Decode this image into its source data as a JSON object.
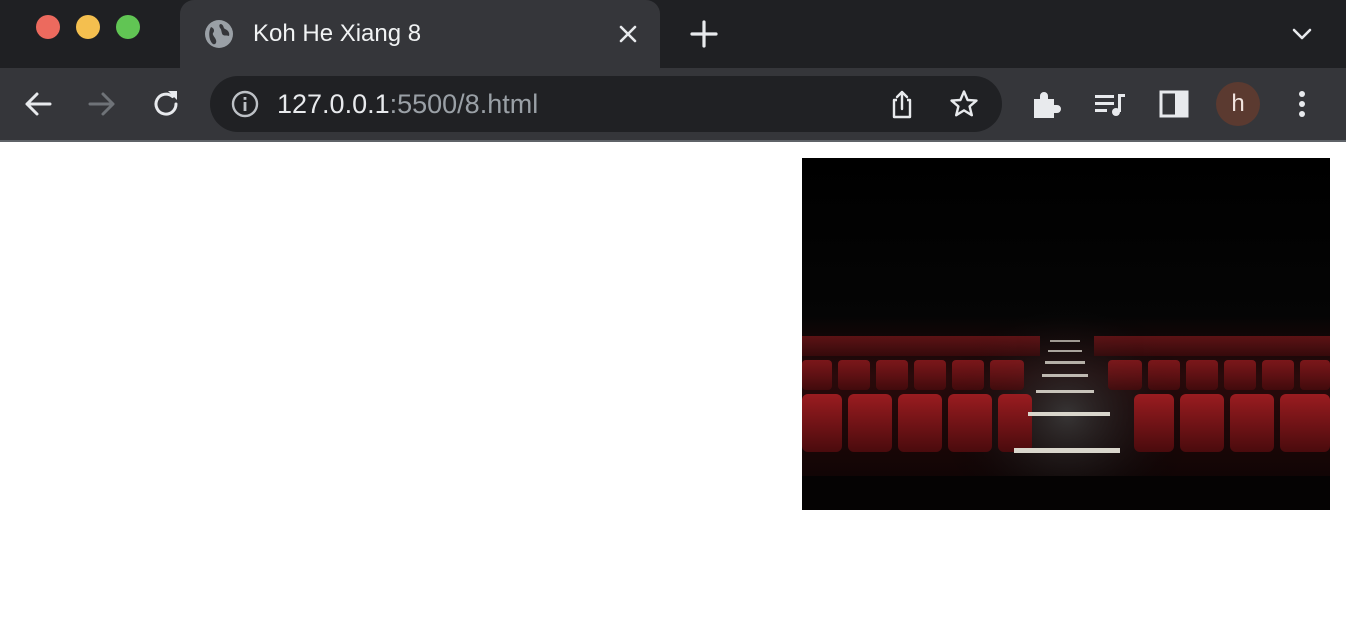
{
  "window": {
    "controls": [
      "close",
      "minimize",
      "maximize"
    ]
  },
  "tab": {
    "title": "Koh He Xiang 8",
    "icon": "globe-icon"
  },
  "toolbar": {
    "url_host": "127.0.0.1",
    "url_path": ":5500/8.html",
    "profile_initial": "h",
    "icons": [
      "back-icon",
      "forward-icon",
      "reload-icon",
      "info-icon",
      "share-icon",
      "star-icon",
      "extensions-icon",
      "media-icon",
      "side-panel-icon",
      "menu-icon"
    ]
  },
  "page": {
    "image": {
      "subject": "theater-seats",
      "colors": {
        "background": "#050505",
        "seats": "#7a1518",
        "stair_lights": "#d9d6cc"
      }
    }
  },
  "colors": {
    "tabbar_bg": "#1f2023",
    "active_tab_bg": "#35363a",
    "omnibox_bg": "#202124",
    "avatar_bg": "#5b3a30"
  }
}
